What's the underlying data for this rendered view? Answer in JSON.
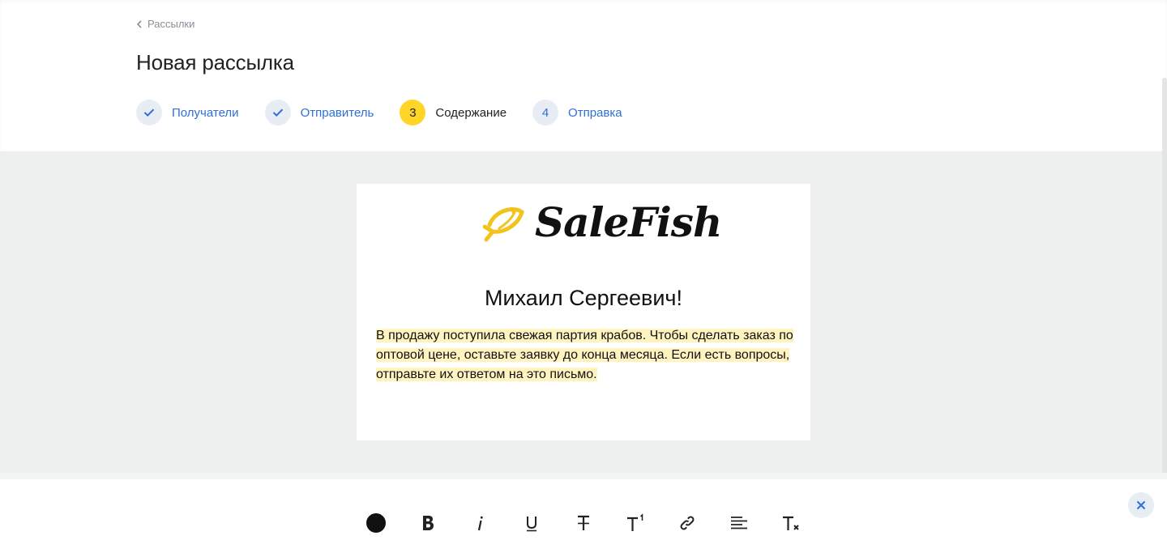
{
  "breadcrumb": {
    "label": "Рассылки"
  },
  "page": {
    "title": "Новая рассылка"
  },
  "steps": [
    {
      "number": "",
      "label": "Получатели",
      "state": "done"
    },
    {
      "number": "",
      "label": "Отправитель",
      "state": "done"
    },
    {
      "number": "3",
      "label": "Содержание",
      "state": "active"
    },
    {
      "number": "4",
      "label": "Отправка",
      "state": "pending"
    }
  ],
  "email": {
    "logo_text": "SaleFish",
    "greeting": "Михаил Сергеевич!",
    "body": "В продажу поступила свежая партия крабов. Чтобы сделать заказ по оптовой цене, оставьте заявку до конца месяца. Если есть вопросы, отправьте их ответом на это письмо."
  },
  "toolbar": {
    "tools": [
      "text-color-icon",
      "bold-icon",
      "italic-icon",
      "underline-icon",
      "strikethrough-icon",
      "superscript-icon",
      "link-icon",
      "align-left-icon",
      "clear-format-icon"
    ]
  },
  "colors": {
    "accent": "#2f6fd6",
    "active_step": "#ffd627",
    "highlight": "#fff3bf",
    "logo_yellow": "#f2c31d"
  }
}
